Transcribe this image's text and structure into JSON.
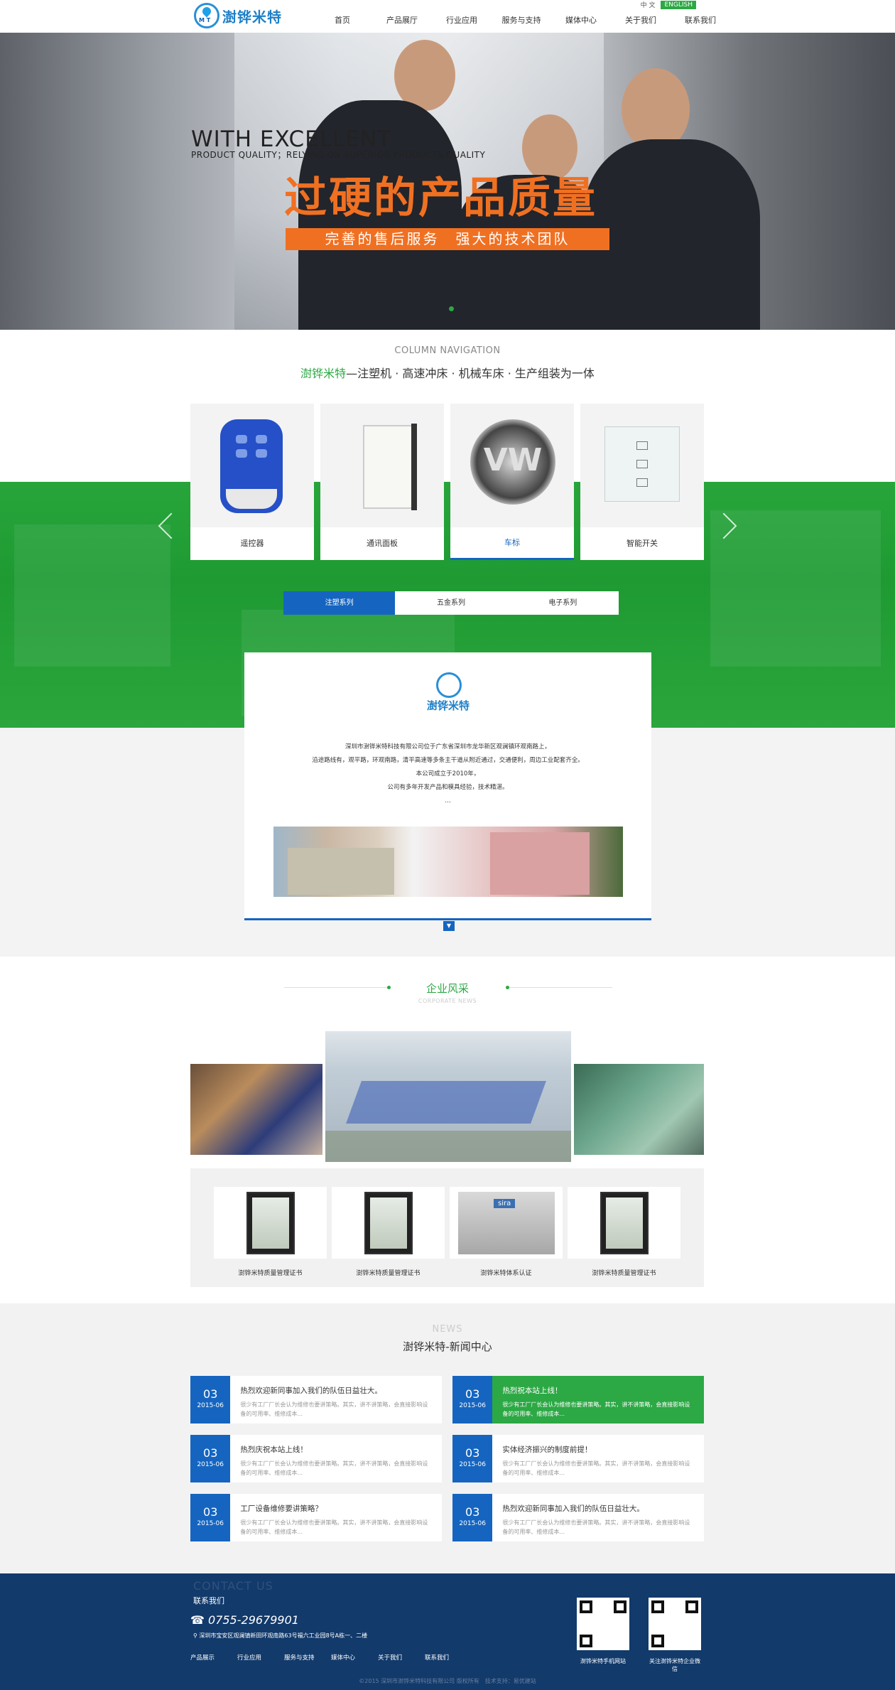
{
  "header": {
    "logo_text": "澍铧米特",
    "lang_cn": "中 文",
    "lang_en": "ENGLISH",
    "nav": [
      "首页",
      "产品展厅",
      "行业应用",
      "服务与支持",
      "媒体中心",
      "关于我们",
      "联系我们"
    ]
  },
  "hero": {
    "title_en": "WITH EXCELLENT",
    "subtitle_en": "PRODUCT QUALITY；RELYING ON SUPERIOR PRODUCTS QUALITY",
    "title_cn": "过硬的产品质量",
    "bar_text": "完善的售后服务　强大的技术团队"
  },
  "column_nav": {
    "en": "COLUMN NAVIGATION",
    "brand": "澍铧米特",
    "desc": "—注塑机 · 高速冲床 · 机械车床 · 生产组装为一体",
    "products": [
      "遥控器",
      "通讯面板",
      "车标",
      "智能开关"
    ],
    "active_index": 2
  },
  "tabs": [
    "注塑系列",
    "五金系列",
    "电子系列"
  ],
  "about": {
    "logo_text": "澍铧米特",
    "lines": [
      "深圳市澍铧米特科技有限公司位于广东省深圳市龙华新区观澜镇环观南路上，",
      "沿途路线有，观平路，环观南路，清平高速等多条主干道从附近通过，交通便利，周边工业配套齐全。",
      "本公司成立于2010年，",
      "公司有多年开发产品和模具经验，技术精湛。",
      "…"
    ]
  },
  "corporate": {
    "title": "企业风采",
    "subtitle": "CORPORATE NEWS",
    "certs": [
      "澍铧米特质量管理证书",
      "澍铧米特质量管理证书",
      "澍铧米特体系认证",
      "澍铧米特质量管理证书"
    ]
  },
  "news": {
    "en": "NEWS",
    "cn": "澍铧米特-新闻中心",
    "items": [
      {
        "day": "03",
        "month": "2015-06",
        "title": "热烈欢迎新同事加入我们的队伍日益壮大。",
        "summary": "很少有工厂厂长会认为维修也要讲策略。其实，讲不讲策略，会直接影响设备的可用率、维修成本..."
      },
      {
        "day": "03",
        "month": "2015-06",
        "title": "热烈祝本站上线！",
        "summary": "很少有工厂厂长会认为维修也要讲策略。其实，讲不讲策略，会直接影响设备的可用率、维修成本..."
      },
      {
        "day": "03",
        "month": "2015-06",
        "title": "热烈庆祝本站上线！",
        "summary": "很少有工厂厂长会认为维修也要讲策略。其实，讲不讲策略，会直接影响设备的可用率、维修成本..."
      },
      {
        "day": "03",
        "month": "2015-06",
        "title": "实体经济振兴的制度前提！",
        "summary": "很少有工厂厂长会认为维修也要讲策略。其实，讲不讲策略，会直接影响设备的可用率、维修成本..."
      },
      {
        "day": "03",
        "month": "2015-06",
        "title": "工厂设备维修要讲策略？",
        "summary": "很少有工厂厂长会认为维修也要讲策略。其实，讲不讲策略，会直接影响设备的可用率、维修成本..."
      },
      {
        "day": "03",
        "month": "2015-06",
        "title": "热烈欢迎新同事加入我们的队伍日益壮大。",
        "summary": "很少有工厂厂长会认为维修也要讲策略。其实，讲不讲策略，会直接影响设备的可用率、维修成本..."
      }
    ],
    "highlight_index": 1
  },
  "footer": {
    "ghost": "CONTACT US",
    "title": "联系我们",
    "phone": "0755-29679901",
    "address": "深圳市宝安区观澜镇新田环观南路63号福六工业园8号A栋一、二楼",
    "links": [
      "产品展示",
      "行业应用",
      "服务与支持",
      "媒体中心",
      "关于我们",
      "联系我们"
    ],
    "qr1": "澍铧米特手机网站",
    "qr2": "关注澍铧米特企业微信",
    "copyright": "©2015 深圳市澍铧米特科技有限公司 版权所有　技术支持：易优建站"
  },
  "colors": {
    "green": "#2ca844",
    "blue": "#1565c0",
    "orange": "#f07022",
    "footer": "#123a6b"
  }
}
